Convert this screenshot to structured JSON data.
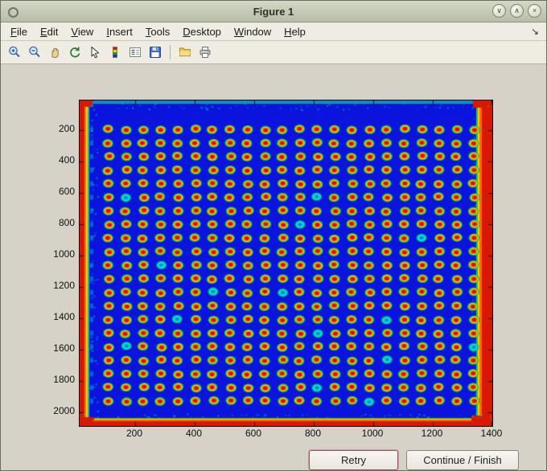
{
  "window": {
    "title": "Figure 1",
    "controls": {
      "minimize": "∨",
      "maximize": "∧",
      "close": "×"
    }
  },
  "menu": {
    "items": [
      {
        "accel": "F",
        "rest": "ile"
      },
      {
        "accel": "E",
        "rest": "dit"
      },
      {
        "accel": "V",
        "rest": "iew"
      },
      {
        "accel": "I",
        "rest": "nsert"
      },
      {
        "accel": "T",
        "rest": "ools"
      },
      {
        "accel": "D",
        "rest": "esktop"
      },
      {
        "accel": "W",
        "rest": "indow"
      },
      {
        "accel": "H",
        "rest": "elp"
      }
    ],
    "dock_arrow": "↘"
  },
  "toolbar": {
    "icons": [
      "zoom-in",
      "zoom-out",
      "pan-hand",
      "rotate-3d",
      "data-cursor",
      "colorbar",
      "insert-legend",
      "save",
      "open-folder",
      "print"
    ]
  },
  "plot": {
    "x_ticks": [
      "200",
      "400",
      "600",
      "800",
      "1000",
      "1200",
      "1400"
    ],
    "y_ticks": [
      "200",
      "400",
      "600",
      "800",
      "1000",
      "1200",
      "1400",
      "1600",
      "1800",
      "2000"
    ],
    "image": {
      "rows": 21,
      "cols": 22,
      "background": "#0a14dc",
      "edge_color": "#d81800",
      "edge_orange": "#ff6a00",
      "edge_yellow": "#ffd000",
      "edge_green": "#22c020",
      "edge_cyan": "#00c8c8",
      "dot_core": "#dd2000",
      "dot_mid": "#ff7000",
      "dot_ring": "#ffd800",
      "dot_ring_alt": "#c6e800",
      "dot_halo": "#00c060",
      "teal_dot": "#00e8c8"
    }
  },
  "buttons": {
    "retry": "Retry",
    "continue_finish": "Continue / Finish"
  }
}
